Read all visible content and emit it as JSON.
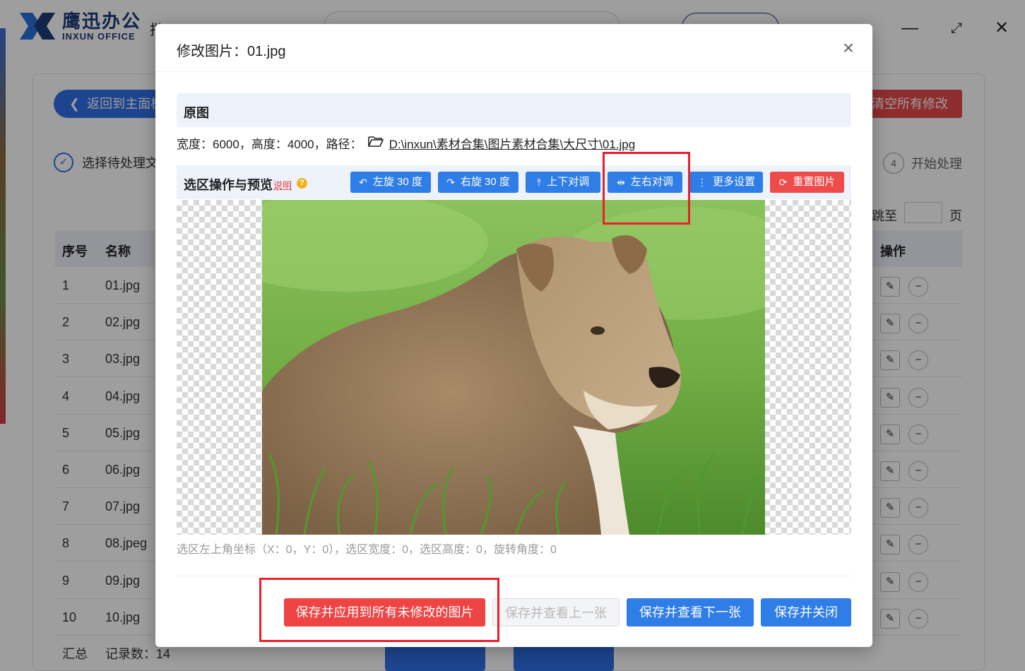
{
  "app": {
    "brand_cn": "鹰迅办公",
    "brand_en": "INXUN OFFICE",
    "title_nav_char": "批",
    "window_controls": [
      "minimize-icon",
      "restore-icon",
      "close-icon"
    ],
    "back_button": "返回到主面板",
    "clear_all_button": "清空所有修改",
    "steps": {
      "step1_label": "选择待处理文",
      "step4_number": "4",
      "step4_label": "开始处理"
    },
    "pager": {
      "jump_label": "跳至",
      "page_label": "页"
    },
    "table": {
      "headers": {
        "no": "序号",
        "name": "名称",
        "action": "操作"
      },
      "rows": [
        {
          "no": "1",
          "name": "01.jpg"
        },
        {
          "no": "2",
          "name": "02.jpg"
        },
        {
          "no": "3",
          "name": "03.jpg"
        },
        {
          "no": "4",
          "name": "04.jpg"
        },
        {
          "no": "5",
          "name": "05.jpg"
        },
        {
          "no": "6",
          "name": "06.jpg"
        },
        {
          "no": "7",
          "name": "07.jpg"
        },
        {
          "no": "8",
          "name": "08.jpeg"
        },
        {
          "no": "9",
          "name": "09.jpg"
        },
        {
          "no": "10",
          "name": "10.jpg"
        }
      ]
    },
    "summary": {
      "label": "汇总",
      "record_count": "记录数：14"
    }
  },
  "dialog": {
    "title": "修改图片：01.jpg",
    "original_section": "原图",
    "info": {
      "dimensions": "宽度：6000，高度：4000，路径：",
      "path": "D:\\inxun\\素材合集\\图片素材合集\\大尺寸\\01.jpg"
    },
    "selection_section": "选区操作与预览",
    "help_link": "说明",
    "help_badge": "?",
    "toolbar": {
      "rotate_left": "左旋 30 度",
      "rotate_right": "右旋 30 度",
      "flip_vertical": "上下对调",
      "flip_horizontal": "左右对调",
      "more_settings": "更多设置",
      "reset_image": "重置图片"
    },
    "coord_line": "选区左上角坐标（X：0，Y：0），选区宽度：0，选区高度：0，旋转角度：0",
    "footer": {
      "save_apply_all": "保存并应用到所有未修改的图片",
      "save_prev": "保存并查看上一张",
      "save_next": "保存并查看下一张",
      "save_close": "保存并关闭"
    }
  },
  "colors": {
    "primary_blue": "#2f7de6",
    "danger_red": "#ee4444",
    "highlight_red": "#e8202a",
    "brand_navy": "#1c3a78"
  }
}
